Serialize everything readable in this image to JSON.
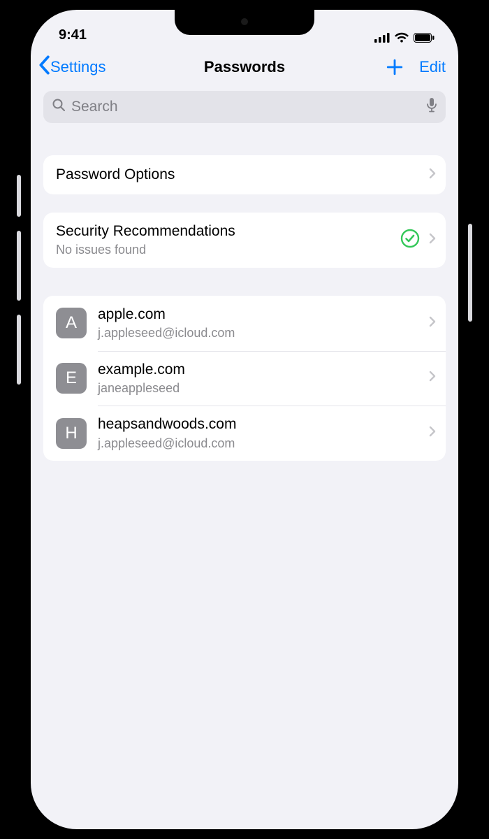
{
  "status": {
    "time": "9:41"
  },
  "nav": {
    "back_label": "Settings",
    "title": "Passwords",
    "edit_label": "Edit"
  },
  "search": {
    "placeholder": "Search"
  },
  "password_options": {
    "label": "Password Options"
  },
  "security": {
    "title": "Security Recommendations",
    "subtitle": "No issues found"
  },
  "accounts": [
    {
      "letter": "A",
      "site": "apple.com",
      "user": "j.appleseed@icloud.com"
    },
    {
      "letter": "E",
      "site": "example.com",
      "user": "janeappleseed"
    },
    {
      "letter": "H",
      "site": "heapsandwoods.com",
      "user": "j.appleseed@icloud.com"
    }
  ],
  "colors": {
    "tint": "#007aff",
    "ok": "#34c759"
  }
}
